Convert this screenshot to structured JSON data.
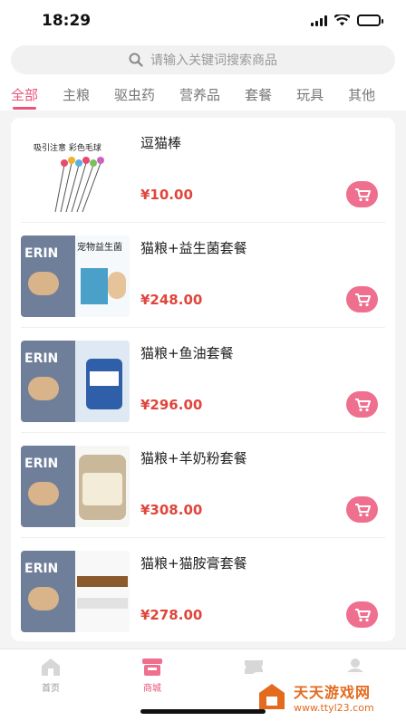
{
  "status_bar": {
    "time": "18:29"
  },
  "search": {
    "placeholder": "请输入关键词搜索商品"
  },
  "tabs": [
    {
      "label": "全部",
      "active": true
    },
    {
      "label": "主粮",
      "active": false
    },
    {
      "label": "驱虫药",
      "active": false
    },
    {
      "label": "营养品",
      "active": false
    },
    {
      "label": "套餐",
      "active": false
    },
    {
      "label": "玩具",
      "active": false
    },
    {
      "label": "其他",
      "active": false
    }
  ],
  "products": [
    {
      "name": "逗猫棒",
      "price": "¥10.00",
      "thumb_caption": "吸引注意  彩色毛球"
    },
    {
      "name": "猫粮+益生菌套餐",
      "price": "¥248.00",
      "thumb_caption": "宠物益生菌"
    },
    {
      "name": "猫粮+鱼油套餐",
      "price": "¥296.00",
      "thumb_caption": ""
    },
    {
      "name": "猫粮+羊奶粉套餐",
      "price": "¥308.00",
      "thumb_caption": ""
    },
    {
      "name": "猫粮+猫胺膏套餐",
      "price": "¥278.00",
      "thumb_caption": ""
    }
  ],
  "thumb_brand": "ERIN",
  "tabbar": [
    {
      "label": "首页",
      "icon": "home-icon",
      "active": false
    },
    {
      "label": "商城",
      "icon": "shop-icon",
      "active": true
    },
    {
      "label": "",
      "icon": "ticket-icon",
      "active": false
    },
    {
      "label": "",
      "icon": "user-icon",
      "active": false
    }
  ],
  "watermark": {
    "title": "天天游戏网",
    "url": "www.ttyl23.com"
  },
  "colors": {
    "accent": "#e8547a",
    "price": "#e0453c",
    "cart": "#ee6f8e"
  }
}
